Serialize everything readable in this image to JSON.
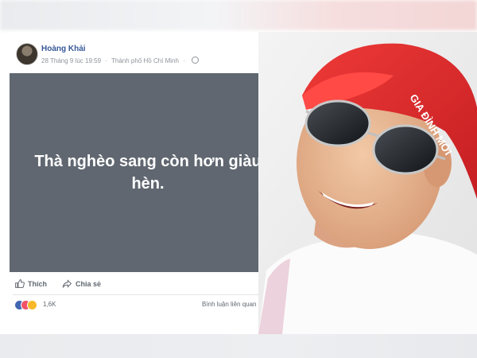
{
  "post": {
    "author": "Hoàng Khải",
    "date": "28 Tháng 9 lúc 19:59",
    "separator": "·",
    "location": "Thành phố Hồ Chí Minh",
    "more": "···",
    "status_text": "Thà nghèo sang còn hơn giàu hèn.",
    "like_label": "Thích",
    "share_label": "Chia sẻ",
    "reaction_count": "1,6K",
    "related_label": "Bình luận liên quan nhất",
    "reaction_icons": [
      "like-icon",
      "love-icon",
      "haha-icon"
    ]
  },
  "photo": {
    "cap_text": "GIA ĐÌNH MỚI",
    "cap_color": "#e4262c"
  },
  "colors": {
    "link_blue": "#365899",
    "status_bg": "#606770",
    "meta_gray": "#90949c"
  }
}
